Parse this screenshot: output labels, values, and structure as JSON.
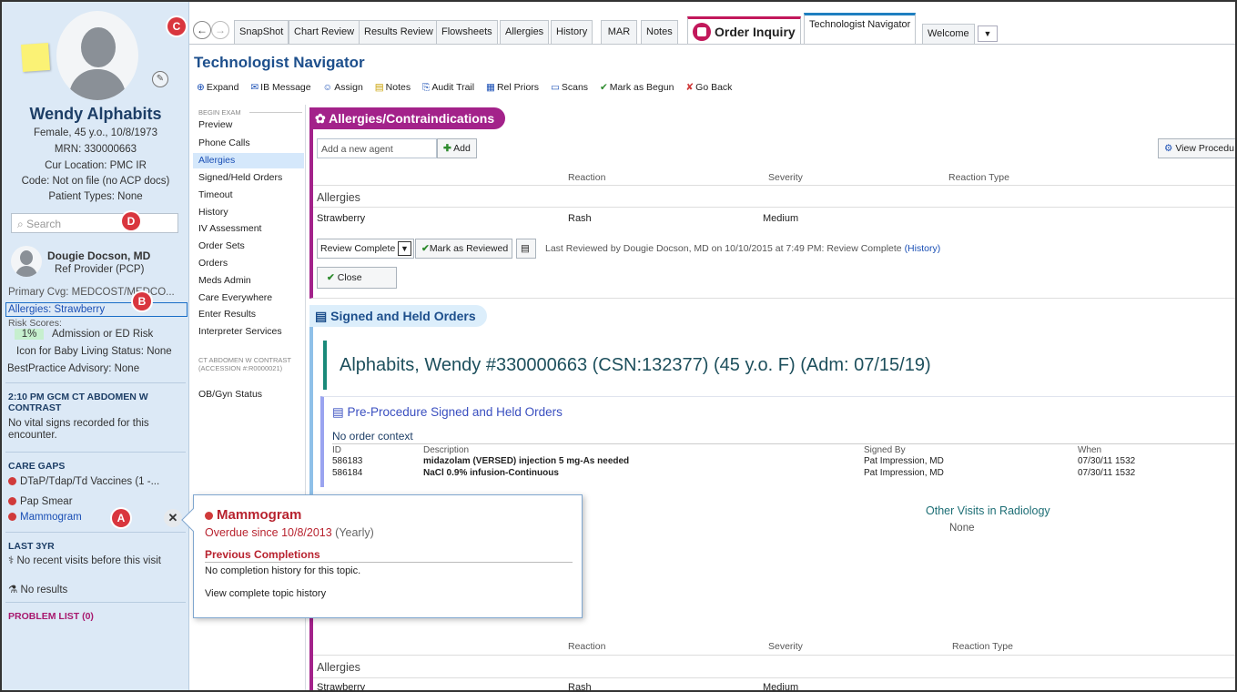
{
  "patient": {
    "name": "Wendy Alphabits",
    "demographics": "Female, 45 y.o., 10/8/1973",
    "mrn": "MRN: 330000663",
    "location": "Cur Location: PMC IR",
    "code": "Code: Not on file (no ACP docs)",
    "types": "Patient Types: None"
  },
  "search": {
    "placeholder": "Search"
  },
  "markers": {
    "a": "A",
    "b": "B",
    "c": "C",
    "d": "D"
  },
  "provider": {
    "name": "Dougie Docson, MD",
    "role": "Ref Provider (PCP)"
  },
  "sidebar": {
    "coverage": "Primary Cvg: MEDCOST/MEDCO...",
    "allergies": "Allergies: Strawberry",
    "risk_label": "Risk Scores:",
    "risk_pct": "1%",
    "risk_text": "Admission or ED Risk",
    "baby": "Icon for Baby Living Status: None",
    "bpa": "BestPractice Advisory: None",
    "encounter_head": "2:10 PM GCM CT ABDOMEN W CONTRAST",
    "vitals": "No vital signs recorded for this encounter.",
    "care_gaps_head": "CARE GAPS",
    "care_gaps": [
      "DTaP/Tdap/Td Vaccines (1 -...",
      "Pap Smear",
      "Mammogram"
    ],
    "last3yr_head": "LAST 3YR",
    "no_visits": "No recent visits before this visit",
    "no_results": "No results",
    "problem_list": "PROBLEM LIST (0)"
  },
  "tabs": [
    "SnapShot",
    "Chart Review",
    "Results Review",
    "Flowsheets",
    "Allergies",
    "History",
    "MAR",
    "Notes",
    "Order Inquiry",
    "Technologist Navigator",
    "Welcome"
  ],
  "page_title": "Technologist Navigator",
  "toolbar": [
    "Expand",
    "IB Message",
    "Assign",
    "Notes",
    "Audit Trail",
    "Rel Priors",
    "Scans",
    "Mark as Begun",
    "Go Back"
  ],
  "leftnav": {
    "begin_caption": "BEGIN EXAM",
    "items": [
      "Preview",
      "Phone Calls",
      "Allergies",
      "Signed/Held Orders",
      "Timeout",
      "History",
      "IV Assessment",
      "Order Sets",
      "Orders",
      "Meds Admin",
      "Care Everywhere",
      "Enter Results",
      "Interpreter Services"
    ],
    "ct_caption": "CT ABDOMEN W CONTRAST (ACCESSION #:R0000021)",
    "ob": "OB/Gyn Status"
  },
  "allergy_section": {
    "title": "Allergies/Contraindications",
    "agent_placeholder": "Add a new agent",
    "add": "Add",
    "view_proc": "View Procedu",
    "headers": [
      "Reaction",
      "Severity",
      "Reaction Type"
    ],
    "group": "Allergies",
    "row": {
      "agent": "Strawberry",
      "reaction": "Rash",
      "severity": "Medium"
    },
    "review_select": "Review Complete",
    "mark_reviewed": "Mark as Reviewed",
    "last_reviewed": "Last Reviewed by Dougie Docson, MD on 10/10/2015 at 7:49 PM: Review Complete",
    "history_link": "(History)",
    "close": "Close"
  },
  "orders_section": {
    "title": "Signed and Held Orders",
    "banner": "Alphabits, Wendy #330000663 (CSN:132377) (45 y.o. F) (Adm: 07/15/19)",
    "sub_title": "Pre-Procedure Signed and Held Orders",
    "no_context": "No order context",
    "headers": [
      "ID",
      "Description",
      "Signed By",
      "When"
    ],
    "rows": [
      {
        "id": "586183",
        "desc": "midazolam (VERSED) injection 5 mg-As needed",
        "by": "Pat Impression, MD",
        "when": "07/30/11 1532"
      },
      {
        "id": "586184",
        "desc": "NaCl 0.9% infusion-Continuous",
        "by": "Pat Impression, MD",
        "when": "07/30/11 1532"
      }
    ],
    "other_visits": "Other Visits in Radiology",
    "other_none": "None"
  },
  "bottom_section": {
    "headers": [
      "Reaction",
      "Severity",
      "Reaction Type"
    ],
    "group": "Allergies",
    "row": {
      "agent": "Strawberry",
      "reaction": "Rash",
      "severity": "Medium"
    }
  },
  "popup": {
    "title": "Mammogram",
    "overdue": "Overdue since 10/8/2013",
    "freq": "(Yearly)",
    "prev_head": "Previous Completions",
    "none": "No completion history for this topic.",
    "link": "View complete topic history"
  }
}
